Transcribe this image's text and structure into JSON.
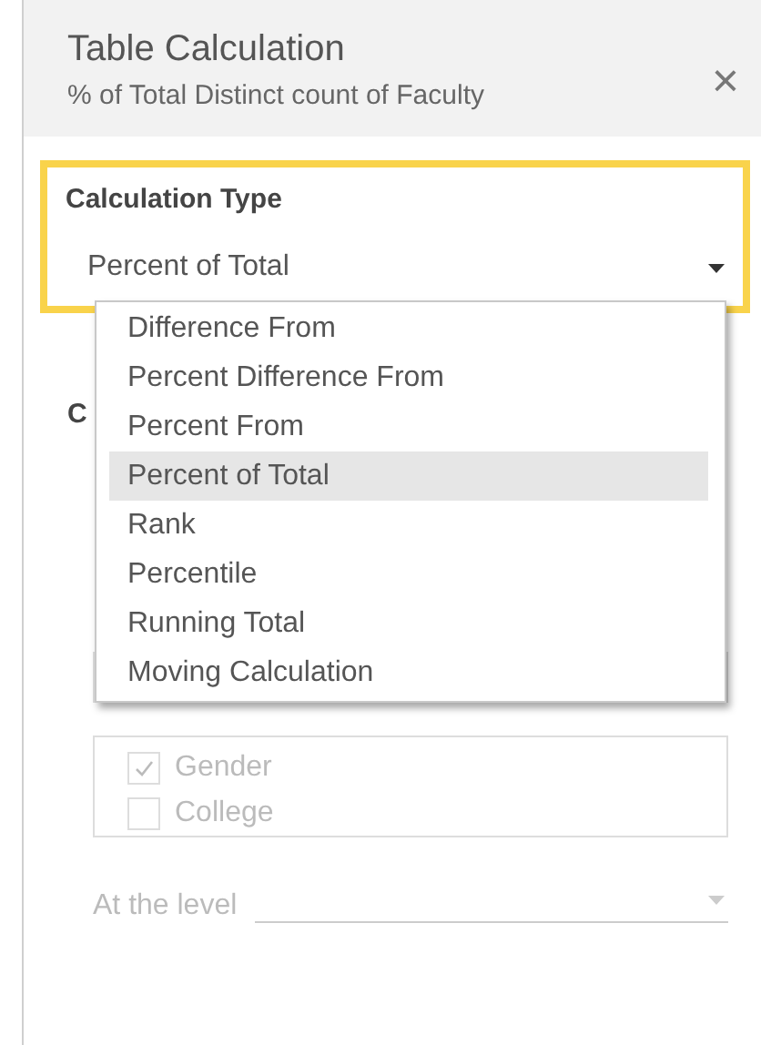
{
  "header": {
    "title": "Table Calculation",
    "subtitle": "% of Total Distinct count of Faculty",
    "close": "×"
  },
  "calculation_type": {
    "label": "Calculation Type",
    "value": "Percent of Total",
    "highlighted": true,
    "expanded": true,
    "options": [
      {
        "label": "Difference From",
        "selected": false
      },
      {
        "label": "Percent Difference From",
        "selected": false
      },
      {
        "label": "Percent From",
        "selected": false
      },
      {
        "label": "Percent of Total",
        "selected": true
      },
      {
        "label": "Rank",
        "selected": false
      },
      {
        "label": "Percentile",
        "selected": false
      },
      {
        "label": "Running Total",
        "selected": false
      },
      {
        "label": "Moving Calculation",
        "selected": false
      }
    ]
  },
  "compute_using": {
    "label": "C"
  },
  "dimensions": {
    "disabled": true,
    "items": [
      {
        "label": "Gender",
        "checked": true
      },
      {
        "label": "College",
        "checked": false
      }
    ]
  },
  "at_the_level": {
    "label": "At the level",
    "disabled": true
  }
}
